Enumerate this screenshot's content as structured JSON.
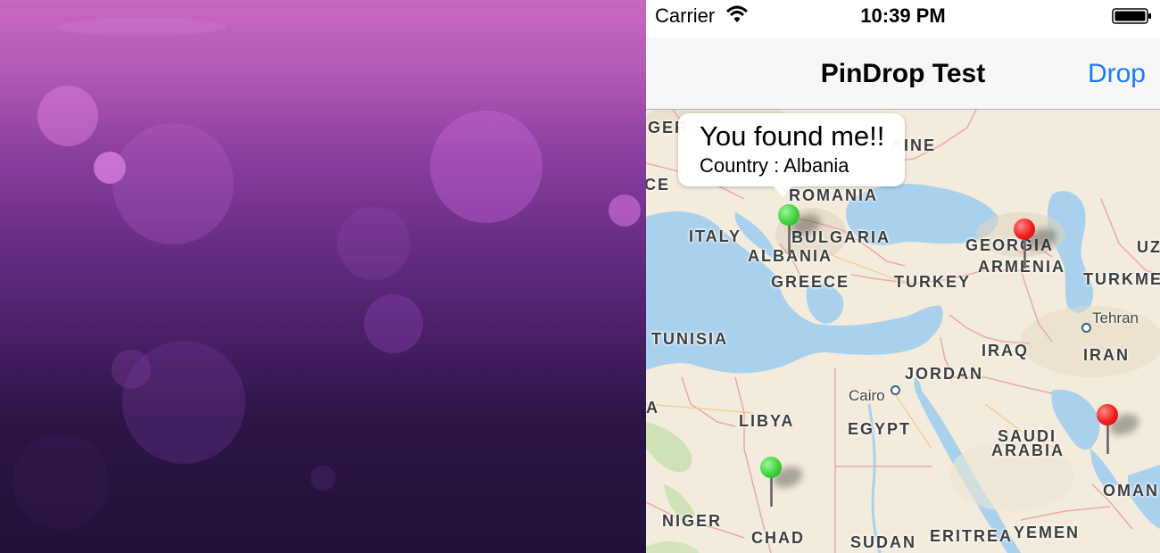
{
  "status_bar": {
    "carrier": "Carrier",
    "time": "10:39 PM"
  },
  "nav_bar": {
    "title": "PinDrop Test",
    "drop_label": "Drop",
    "tint_color": "#1a7df5"
  },
  "callout": {
    "title": "You found me!!",
    "subtitle": "Country : Albania"
  },
  "map_labels": {
    "countries": [
      "GER",
      "CE",
      "AINE",
      "ROMANIA",
      "ITALY",
      "BULGARIA",
      "ALBANIA",
      "GREECE",
      "TURKEY",
      "GEORGIA",
      "ARMENIA",
      "UZ",
      "TURKME",
      "TUNISIA",
      "IRAQ",
      "IRAN",
      "JORDAN",
      "A",
      "LIBYA",
      "EGYPT",
      "SAUDI",
      "ARABIA",
      "NIGER",
      "CHAD",
      "SUDAN",
      "ERITREA",
      "YEMEN",
      "OMAN"
    ],
    "cities": [
      "Tehran",
      "Cairo"
    ]
  },
  "pins": [
    {
      "color": "green",
      "hex": "#3dd23f",
      "location": "Albania"
    },
    {
      "color": "red",
      "hex": "#f21d1d",
      "location": "Armenia"
    },
    {
      "color": "red",
      "hex": "#f21d1d",
      "location": "Persian Gulf"
    },
    {
      "color": "green",
      "hex": "#3dd23f",
      "location": "Chad"
    }
  ],
  "icons": {
    "wifi": "wifi-icon",
    "battery": "battery-icon"
  }
}
